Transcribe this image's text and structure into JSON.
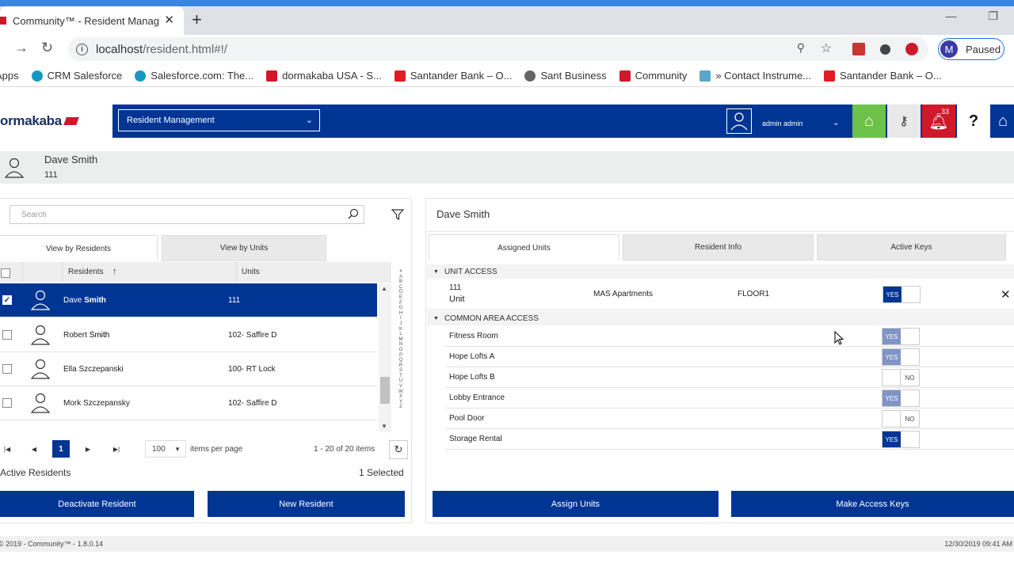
{
  "browser": {
    "tab_title": "Community™ - Resident Manage",
    "url_host": "localhost",
    "url_path": "/resident.html#!/",
    "profile_initial": "M",
    "profile_status": "Paused",
    "bookmarks": [
      "Apps",
      "CRM Salesforce",
      "Salesforce.com: The...",
      "dormakaba USA - S...",
      "Santander Bank – O...",
      "Sant Business",
      "Community",
      "» Contact Instrume...",
      "Santander Bank – O..."
    ]
  },
  "app": {
    "logo": "ormakaba",
    "module": "Resident Management",
    "user": "admin admin",
    "notifications": "33",
    "help": "?"
  },
  "resident": {
    "name": "Dave Smith",
    "unit": "111"
  },
  "left": {
    "search_placeholder": "Search",
    "tabs": [
      "View by Residents",
      "View by Units"
    ],
    "col_residents": "Residents",
    "col_units": "Units",
    "rows": [
      {
        "first": "Dave",
        "last": "Smith",
        "unit": "111"
      },
      {
        "first": "Robert",
        "last": "Smith",
        "unit": "102- Saffire D"
      },
      {
        "first": "Ella",
        "last": "Szczepanski",
        "unit": "100- RT Lock"
      },
      {
        "first": "Mork",
        "last": "Szczepansky",
        "unit": "102- Saffire D"
      }
    ],
    "alphabet": [
      "#",
      "A",
      "B",
      "C",
      "D",
      "E",
      "F",
      "G",
      "H",
      "I",
      "J",
      "K",
      "L",
      "M",
      "N",
      "O",
      "P",
      "Q",
      "R",
      "S",
      "T",
      "U",
      "V",
      "W",
      "X",
      "Y",
      "Z"
    ],
    "page": "1",
    "page_size": "100",
    "items_per_page": "items per page",
    "range": "1 - 20 of 20 items",
    "active_label": "Active Residents",
    "selected": "1 Selected",
    "deactivate": "Deactivate Resident",
    "new_resident": "New Resident"
  },
  "right": {
    "name": "Dave Smith",
    "tabs": [
      "Assigned Units",
      "Resident Info",
      "Active Keys"
    ],
    "unit_access": "UNIT ACCESS",
    "unit": {
      "number": "111",
      "type": "Unit",
      "property": "MAS Apartments",
      "floor": "FLOOR1",
      "value": "YES"
    },
    "common_access": "COMMON AREA ACCESS",
    "areas": [
      {
        "name": "Fitness Room",
        "value": "YES",
        "state": "on-muted"
      },
      {
        "name": "Hope Lofts A",
        "value": "YES",
        "state": "on-muted"
      },
      {
        "name": "Hope Lofts B",
        "value": "NO",
        "state": "off"
      },
      {
        "name": "Lobby Entrance",
        "value": "YES",
        "state": "on-muted"
      },
      {
        "name": "Pool Door",
        "value": "NO",
        "state": "off"
      },
      {
        "name": "Storage Rental",
        "value": "YES",
        "state": "on"
      }
    ],
    "assign_units": "Assign Units",
    "make_keys": "Make Access Keys"
  },
  "footer": {
    "copyright": "© 2019 - Community™ - 1.8.0.14",
    "datetime": "12/30/2019 09:41 AM"
  },
  "colors": {
    "brand": "#003594",
    "green": "#6cc24a",
    "red": "#d0182b"
  }
}
